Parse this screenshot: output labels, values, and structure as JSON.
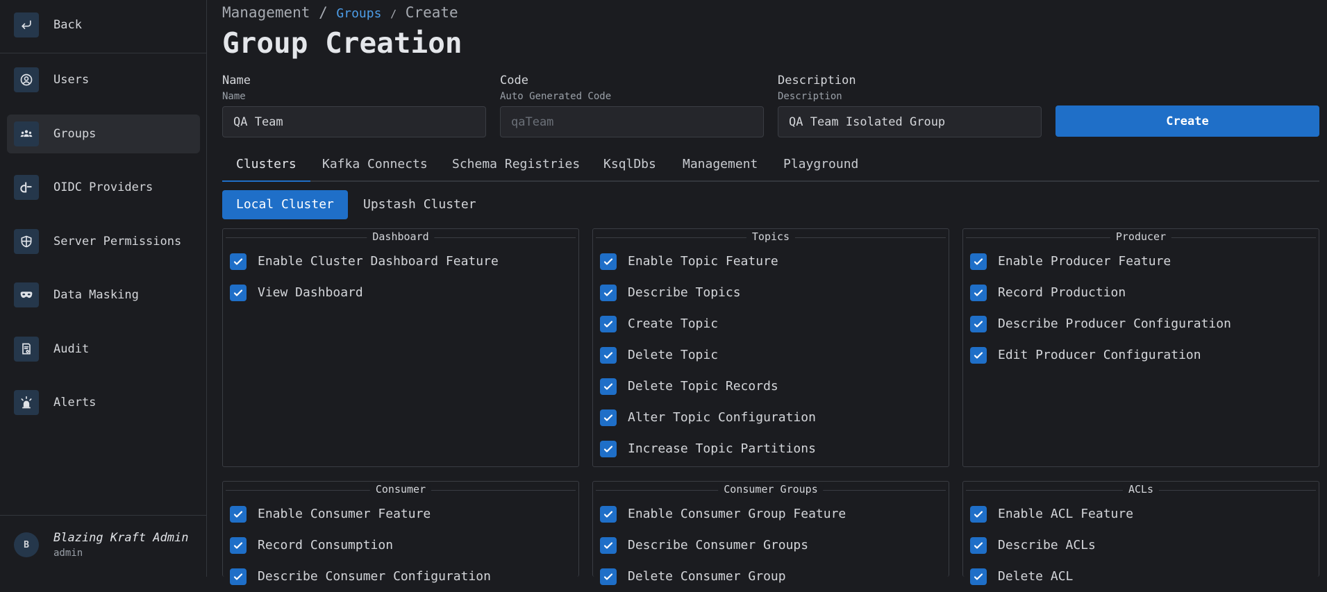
{
  "sidebar": {
    "back_label": "Back",
    "items": [
      {
        "label": "Users",
        "icon": "user-circle-icon"
      },
      {
        "label": "Groups",
        "icon": "users-group-icon",
        "active": true
      },
      {
        "label": "OIDC Providers",
        "icon": "oidc-icon"
      },
      {
        "label": "Server Permissions",
        "icon": "shield-icon"
      },
      {
        "label": "Data Masking",
        "icon": "mask-icon"
      },
      {
        "label": "Audit",
        "icon": "report-icon"
      },
      {
        "label": "Alerts",
        "icon": "alarm-icon"
      }
    ],
    "user": {
      "initial": "B",
      "name": "Blazing Kraft Admin",
      "role": "admin"
    }
  },
  "breadcrumb": {
    "root": "Management",
    "sep1": "/",
    "link": "Groups",
    "sep2": "/",
    "current": "Create"
  },
  "page_title": "Group Creation",
  "form": {
    "name": {
      "label": "Name",
      "sublabel": "Name",
      "value": "QA Team"
    },
    "code": {
      "label": "Code",
      "sublabel": "Auto Generated Code",
      "placeholder": "qaTeam"
    },
    "description": {
      "label": "Description",
      "sublabel": "Description",
      "value": "QA Team Isolated Group"
    },
    "create_label": "Create"
  },
  "tabs": [
    "Clusters",
    "Kafka Connects",
    "Schema Registries",
    "KsqlDbs",
    "Management",
    "Playground"
  ],
  "subtabs": [
    "Local Cluster",
    "Upstash Cluster"
  ],
  "panels": [
    {
      "title": "Dashboard",
      "items": [
        "Enable Cluster Dashboard Feature",
        "View Dashboard"
      ]
    },
    {
      "title": "Topics",
      "items": [
        "Enable Topic Feature",
        "Describe Topics",
        "Create Topic",
        "Delete Topic",
        "Delete Topic Records",
        "Alter Topic Configuration",
        "Increase Topic Partitions"
      ]
    },
    {
      "title": "Producer",
      "items": [
        "Enable Producer Feature",
        "Record Production",
        "Describe Producer Configuration",
        "Edit Producer Configuration"
      ]
    },
    {
      "title": "Consumer",
      "items": [
        "Enable Consumer Feature",
        "Record Consumption",
        "Describe Consumer Configuration"
      ]
    },
    {
      "title": "Consumer Groups",
      "items": [
        "Enable Consumer Group Feature",
        "Describe Consumer Groups",
        "Delete Consumer Group"
      ]
    },
    {
      "title": "ACLs",
      "items": [
        "Enable ACL Feature",
        "Describe ACLs",
        "Delete ACL"
      ]
    }
  ],
  "colors": {
    "accent": "#1f6fc8",
    "link": "#4d9de8",
    "background": "#1b1c20"
  }
}
